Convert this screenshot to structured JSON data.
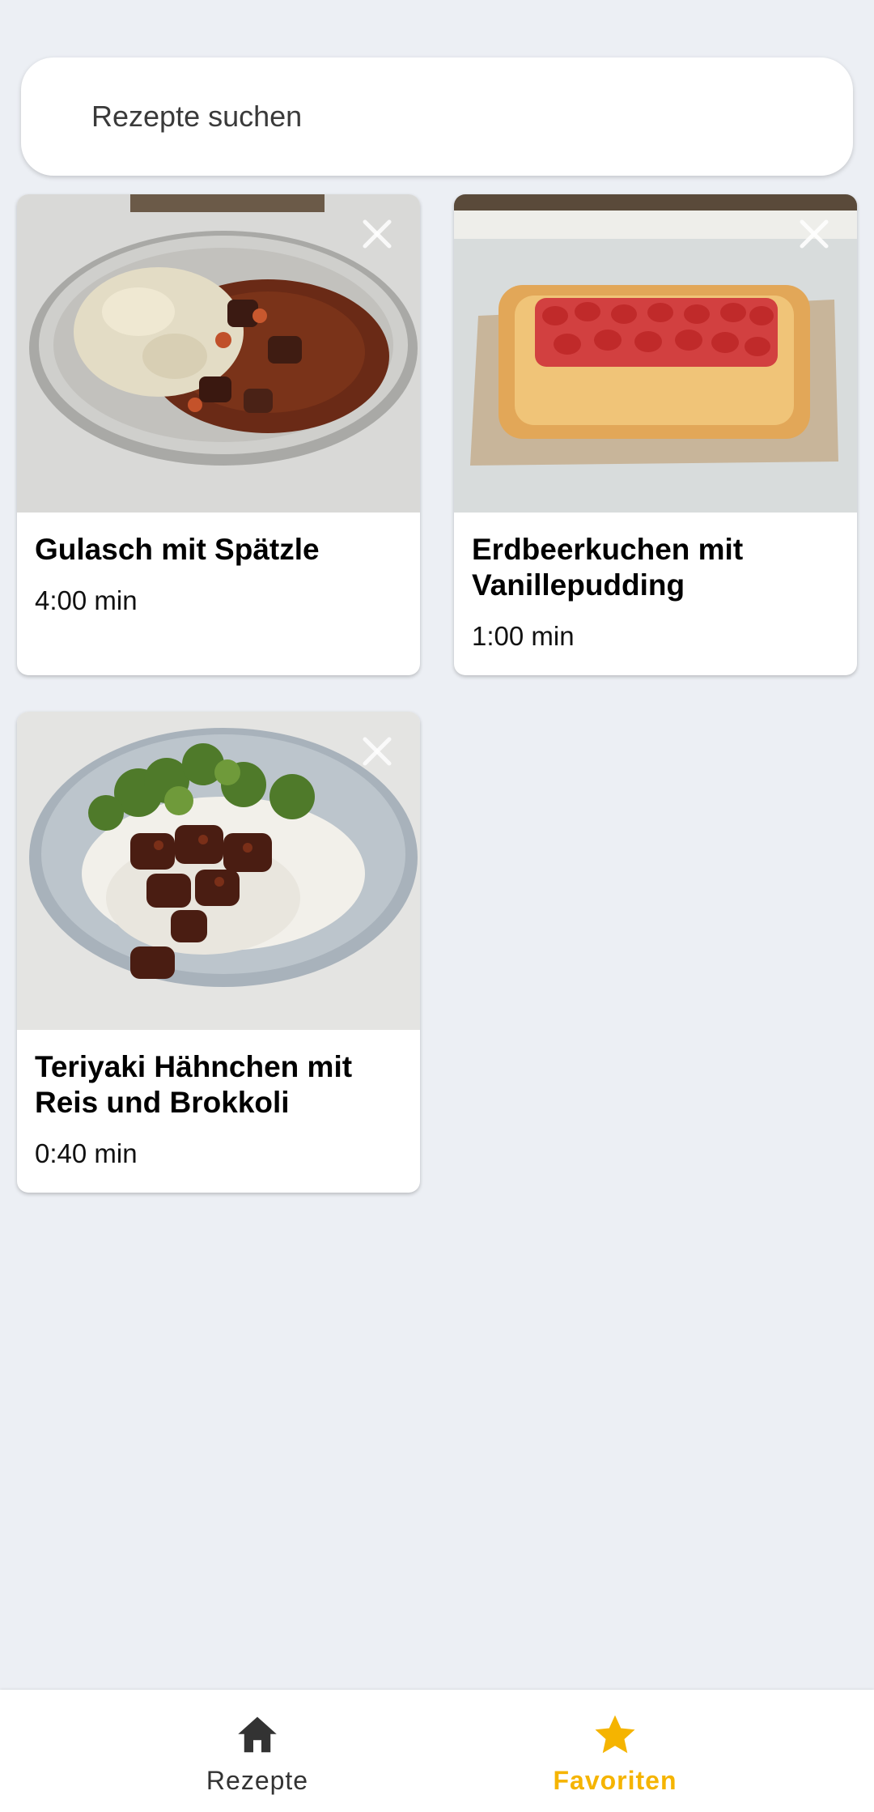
{
  "search": {
    "placeholder": "Rezepte suchen"
  },
  "recipes": [
    {
      "title": "Gulasch mit Spätzle",
      "time": "4:00 min"
    },
    {
      "title": "Erdbeerkuchen mit Vanillepudding",
      "time": "1:00 min"
    },
    {
      "title": "Teriyaki Hähnchen mit Reis und Brokkoli",
      "time": "0:40 min"
    }
  ],
  "bottom_nav": {
    "items": [
      {
        "label": "Rezepte",
        "icon": "home-icon",
        "active": false
      },
      {
        "label": "Favoriten",
        "icon": "star-icon",
        "active": true
      }
    ]
  },
  "colors": {
    "background": "#eceff4",
    "accent": "#f5b400",
    "nav_inactive": "#333333"
  }
}
